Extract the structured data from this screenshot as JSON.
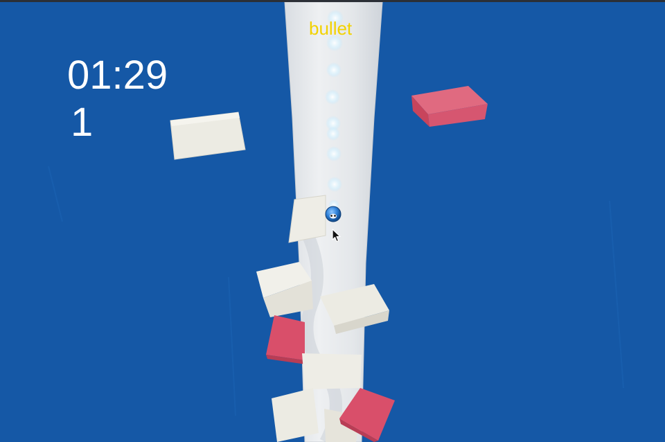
{
  "hud": {
    "timer": "01:29",
    "score": "1"
  },
  "powerup": {
    "label": "bullet",
    "color": "#f2d200"
  },
  "colors": {
    "sky": "#1558a6",
    "tower": "#e4e7ea",
    "safe_platform": "#e8e6dc",
    "danger_platform": "#d94f6a",
    "ball": "#2d7fd6"
  },
  "player": {
    "icon": "ball-face-icon"
  },
  "cursor": {
    "icon": "mouse-pointer-icon"
  }
}
